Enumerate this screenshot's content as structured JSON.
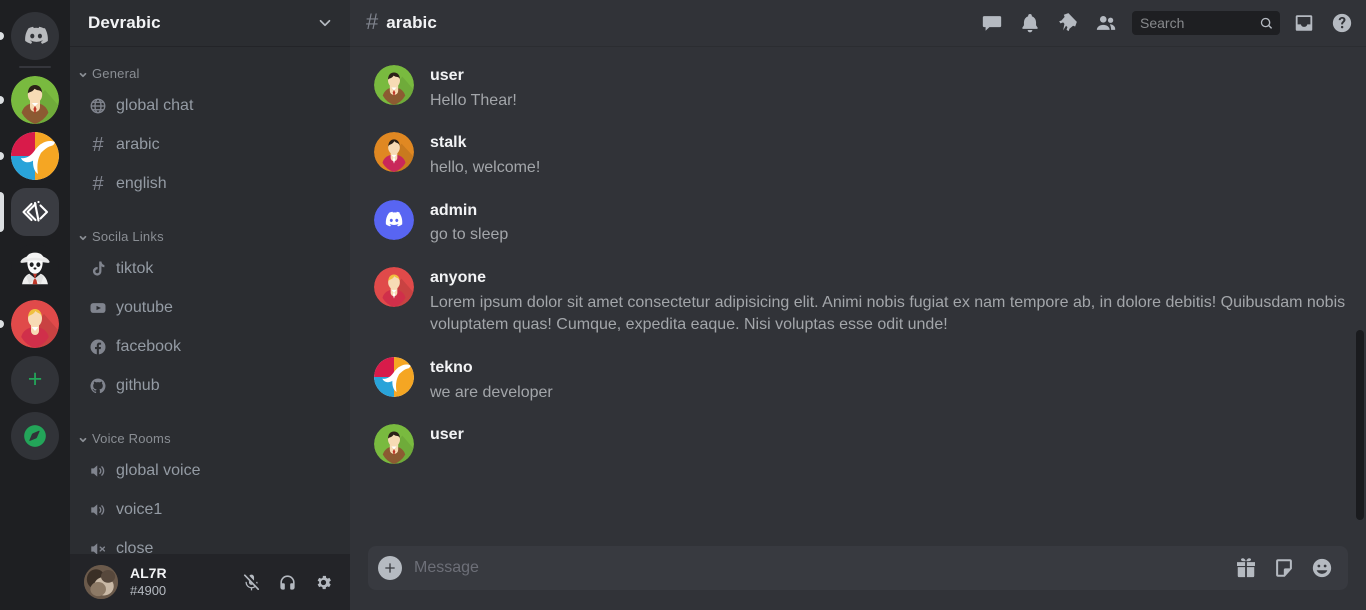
{
  "rail": {
    "servers": [
      {
        "name": "direct-messages",
        "icon": "discord-logo-icon",
        "indicator": "dot",
        "active": false
      },
      {
        "name": "server-green-person",
        "icon": "avatar-green-person-icon",
        "indicator": "dot",
        "active": false
      },
      {
        "name": "server-tekno",
        "icon": "tekno-logo-icon",
        "indicator": "dot",
        "active": false
      },
      {
        "name": "server-devrabic",
        "icon": "code-brackets-icon",
        "indicator": "tall",
        "active": true
      },
      {
        "name": "server-panda",
        "icon": "panda-detective-icon",
        "indicator": "none",
        "active": false
      },
      {
        "name": "server-red-person",
        "icon": "avatar-red-person-icon",
        "indicator": "dot",
        "active": false
      }
    ],
    "add_server_label": "+",
    "explore_label": "explore-servers"
  },
  "sidebar": {
    "guild_name": "Devrabic",
    "categories": [
      {
        "label": "General",
        "channels": [
          {
            "label": "global chat",
            "icon": "globe-icon"
          },
          {
            "label": "arabic",
            "icon": "hash-icon",
            "active": true
          },
          {
            "label": "english",
            "icon": "hash-icon"
          }
        ]
      },
      {
        "label": "Socila Links",
        "channels": [
          {
            "label": "tiktok",
            "icon": "tiktok-icon"
          },
          {
            "label": "youtube",
            "icon": "youtube-icon"
          },
          {
            "label": "facebook",
            "icon": "facebook-icon"
          },
          {
            "label": "github",
            "icon": "github-icon"
          }
        ]
      },
      {
        "label": "Voice Rooms",
        "channels": [
          {
            "label": "global voice",
            "icon": "speaker-icon"
          },
          {
            "label": "voice1",
            "icon": "speaker-icon"
          },
          {
            "label": "close",
            "icon": "speaker-muted-icon"
          }
        ]
      }
    ],
    "user": {
      "name": "AL7R",
      "tag": "#4900",
      "actions": [
        {
          "name": "microphone-muted-icon",
          "label": "mute"
        },
        {
          "name": "headphones-icon",
          "label": "deafen"
        },
        {
          "name": "gear-icon",
          "label": "user-settings"
        }
      ]
    }
  },
  "header": {
    "channel_name": "arabic",
    "channel_icon": "hash-icon",
    "icons": [
      {
        "name": "threads-icon",
        "label": "Threads"
      },
      {
        "name": "bell-icon",
        "label": "Notification Settings"
      },
      {
        "name": "pin-icon",
        "label": "Pinned Messages"
      },
      {
        "name": "members-icon",
        "label": "Member List"
      }
    ],
    "search": {
      "placeholder": "Search",
      "value": "",
      "icon": "search-icon"
    },
    "right_icons": [
      {
        "name": "inbox-icon",
        "label": "Inbox"
      },
      {
        "name": "help-icon",
        "label": "Help"
      }
    ]
  },
  "chat": {
    "messages": [
      {
        "author": "user",
        "text": "Hello Thear!",
        "avatar": "avatar-green-person-icon"
      },
      {
        "author": "stalk",
        "text": "hello, welcome!",
        "avatar": "avatar-orange-person-icon"
      },
      {
        "author": "admin",
        "text": "go to sleep",
        "avatar": "discord-logo-icon"
      },
      {
        "author": "anyone",
        "text": "Lorem ipsum dolor sit amet consectetur adipisicing elit. Animi nobis fugiat ex nam tempore ab, in dolore debitis! Quibusdam nobis voluptatem quas! Cumque, expedita eaque. Nisi voluptas esse odit unde!",
        "avatar": "avatar-red-person-icon"
      },
      {
        "author": "tekno",
        "text": "we are developer",
        "avatar": "tekno-logo-icon"
      },
      {
        "author": "user",
        "text": "",
        "avatar": "avatar-green-person-icon"
      }
    ]
  },
  "composer": {
    "placeholder": "Message",
    "value": "",
    "add_icon": "plus-circle-icon",
    "icons": [
      {
        "name": "gift-icon",
        "label": "Send a gift"
      },
      {
        "name": "sticker-icon",
        "label": "Open sticker picker"
      },
      {
        "name": "emoji-icon",
        "label": "Open emoji picker"
      }
    ]
  },
  "colors": {
    "rail_bg": "#1e1f22",
    "sidebar_bg": "#2b2d31",
    "chat_bg": "#313338",
    "userbar_bg": "#232428",
    "composer_bg": "#383a40",
    "accent_blurple": "#5865f2",
    "accent_green": "#23a559",
    "text_primary": "#f2f3f5",
    "text_muted": "#949ba4"
  }
}
